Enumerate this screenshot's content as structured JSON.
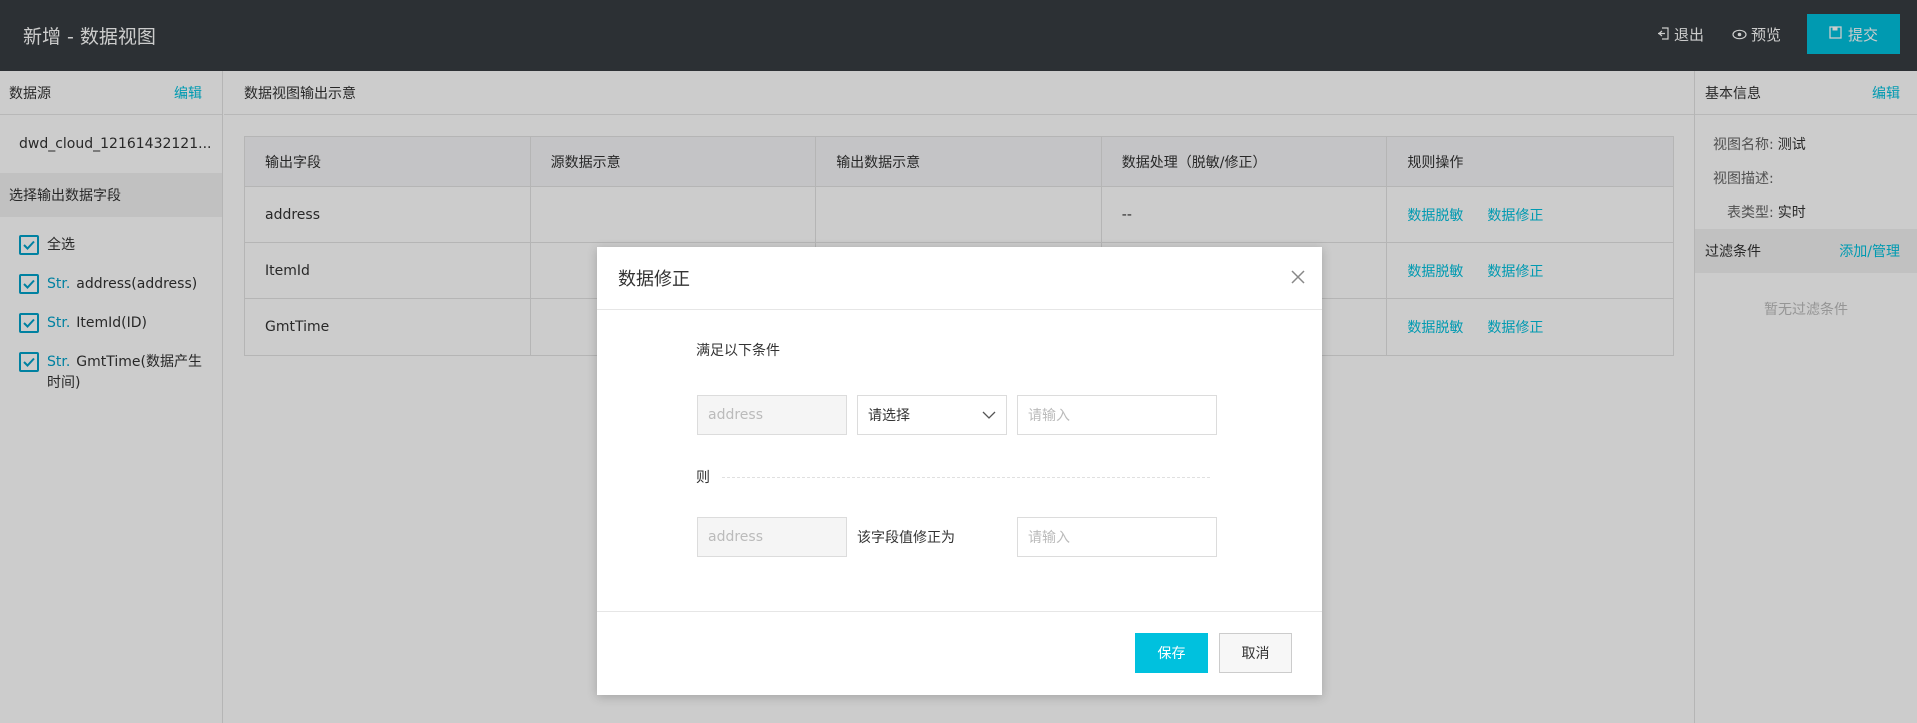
{
  "header": {
    "title": "新增 - 数据视图",
    "exit_label": "退出",
    "preview_label": "预览",
    "submit_label": "提交"
  },
  "left": {
    "source_title": "数据源",
    "source_edit": "编辑",
    "source_name": "dwd_cloud_12161432121...",
    "fields_title": "选择输出数据字段",
    "select_all": "全选",
    "fields": [
      {
        "type": "Str.",
        "label": "address(address)"
      },
      {
        "type": "Str.",
        "label": "ItemId(ID)"
      },
      {
        "type": "Str.",
        "label": "GmtTime(数据产生时间)"
      }
    ]
  },
  "center": {
    "title": "数据视图输出示意",
    "columns": [
      "输出字段",
      "源数据示意",
      "输出数据示意",
      "数据处理（脱敏/修正）",
      "规则操作"
    ],
    "rows": [
      {
        "field": "address",
        "processing": "--"
      },
      {
        "field": "ItemId",
        "processing": ""
      },
      {
        "field": "GmtTime",
        "processing": ""
      }
    ],
    "op_mask": "数据脱敏",
    "op_fix": "数据修正"
  },
  "right": {
    "info_title": "基本信息",
    "info_edit": "编辑",
    "view_name_key": "视图名称:",
    "view_name_val": "测试",
    "view_desc_key": "视图描述:",
    "table_type_key": "表类型:",
    "table_type_val": "实时",
    "filter_title": "过滤条件",
    "filter_manage": "添加/管理",
    "filter_empty": "暂无过滤条件"
  },
  "modal": {
    "title": "数据修正",
    "condition_label": "满足以下条件",
    "field_placeholder": "address",
    "select_placeholder": "请选择",
    "input_placeholder": "请输入",
    "then_label": "则",
    "fix_label": "该字段值修正为",
    "save_label": "保存",
    "cancel_label": "取消"
  },
  "colors": {
    "accent": "#00c1de",
    "header_bg": "#373d41",
    "checkbox": "#00a2ca"
  }
}
